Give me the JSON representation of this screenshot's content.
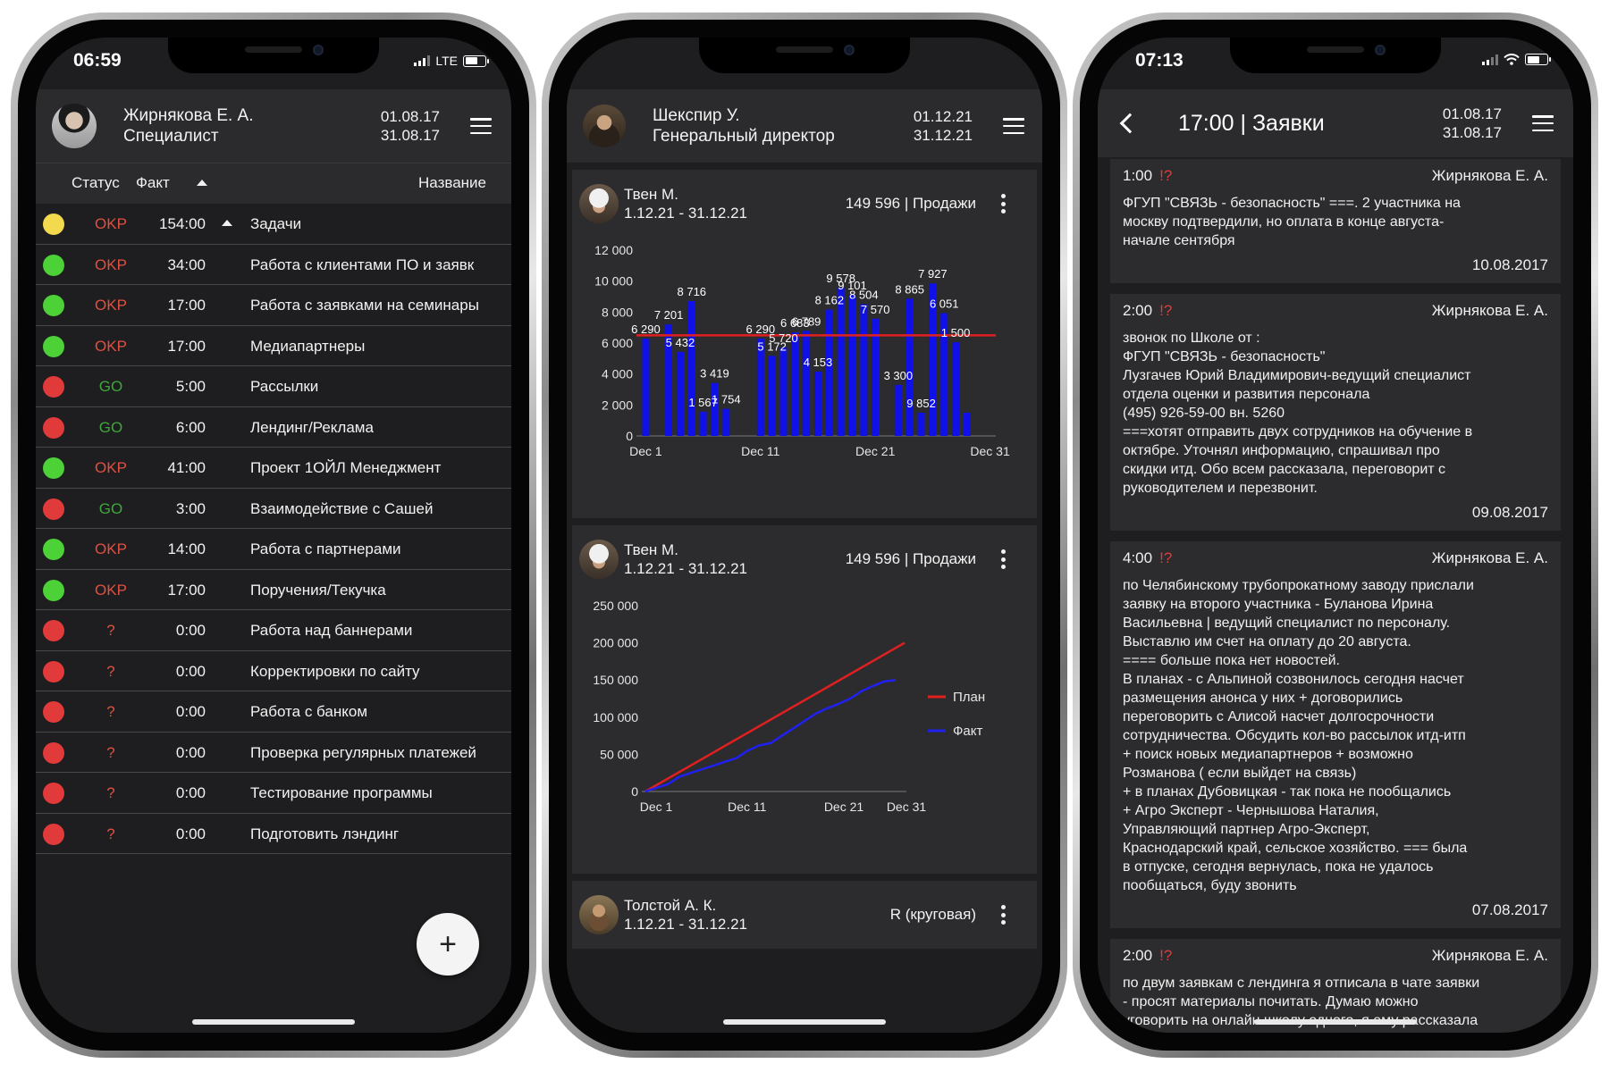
{
  "phone1": {
    "status_time": "06:59",
    "network": "LTE",
    "user_name": "Жирнякова Е. А.",
    "user_role": "Специалист",
    "date_from": "01.08.17",
    "date_to": "31.08.17",
    "columns": {
      "status": "Статус",
      "fact": "Факт",
      "name": "Название"
    },
    "tasks": [
      {
        "dot": "#f2d94e",
        "status": "OKP",
        "status_color": "#e05040",
        "fact": "154:00",
        "title": "Задачи",
        "arrow": true
      },
      {
        "dot": "#4cd137",
        "status": "OKP",
        "status_color": "#e05040",
        "fact": "34:00",
        "title": "Работа с клиентами ПО и заявк"
      },
      {
        "dot": "#4cd137",
        "status": "OKP",
        "status_color": "#e05040",
        "fact": "17:00",
        "title": "Работа с заявками на семинары"
      },
      {
        "dot": "#4cd137",
        "status": "OKP",
        "status_color": "#e05040",
        "fact": "17:00",
        "title": "Медиапартнеры"
      },
      {
        "dot": "#e03a3a",
        "status": "GO",
        "status_color": "#3fa83a",
        "fact": "5:00",
        "title": "Рассылки"
      },
      {
        "dot": "#e03a3a",
        "status": "GO",
        "status_color": "#3fa83a",
        "fact": "6:00",
        "title": "Лендинг/Реклама"
      },
      {
        "dot": "#4cd137",
        "status": "OKP",
        "status_color": "#e05040",
        "fact": "41:00",
        "title": "Проект 1ОЙЛ Менеджмент"
      },
      {
        "dot": "#e03a3a",
        "status": "GO",
        "status_color": "#3fa83a",
        "fact": "3:00",
        "title": "Взаимодействие с Сашей"
      },
      {
        "dot": "#4cd137",
        "status": "OKP",
        "status_color": "#e05040",
        "fact": "14:00",
        "title": "Работа с партнерами"
      },
      {
        "dot": "#4cd137",
        "status": "OKP",
        "status_color": "#e05040",
        "fact": "17:00",
        "title": "Поручения/Текучка"
      },
      {
        "dot": "#e03a3a",
        "status": "?",
        "status_color": "#e05040",
        "fact": "0:00",
        "title": "Работа над баннерами"
      },
      {
        "dot": "#e03a3a",
        "status": "?",
        "status_color": "#e05040",
        "fact": "0:00",
        "title": "Корректировки по сайту"
      },
      {
        "dot": "#e03a3a",
        "status": "?",
        "status_color": "#e05040",
        "fact": "0:00",
        "title": "Работа с банком"
      },
      {
        "dot": "#e03a3a",
        "status": "?",
        "status_color": "#e05040",
        "fact": "0:00",
        "title": "Проверка регулярных платежей"
      },
      {
        "dot": "#e03a3a",
        "status": "?",
        "status_color": "#e05040",
        "fact": "0:00",
        "title": "Тестирование программы"
      },
      {
        "dot": "#e03a3a",
        "status": "?",
        "status_color": "#e05040",
        "fact": "0:00",
        "title": "Подготовить лэндинг"
      }
    ],
    "fab_label": "+"
  },
  "phone2": {
    "user_name": "Шекспир У.",
    "user_role": "Генеральный директор",
    "date_from": "01.12.21",
    "date_to": "31.12.21",
    "cards": [
      {
        "name": "Твен М.",
        "period": "1.12.21 - 31.12.21",
        "summary": "149 596 | Продажи"
      },
      {
        "name": "Твен М.",
        "period": "1.12.21 - 31.12.21",
        "summary": "149 596 | Продажи"
      },
      {
        "name": "Толстой А. К.",
        "period": "1.12.21 - 31.12.21",
        "summary": "R (круговая)"
      }
    ]
  },
  "phone3": {
    "status_time": "07:13",
    "title": "17:00 | Заявки",
    "date_from": "01.08.17",
    "date_to": "31.08.17",
    "requests": [
      {
        "time": "1:00",
        "flag": "!?",
        "author": "Жирнякова Е. А.",
        "text": "ФГУП \"СВЯЗЬ - безопасность\"  ===. 2 участника на\nмоскву подтвердили, но оплата в конце августа-\nначале сентября",
        "date": "10.08.2017"
      },
      {
        "time": "2:00",
        "flag": "!?",
        "author": "Жирнякова Е. А.",
        "text": "звонок по Школе от :\nФГУП \"СВЯЗЬ - безопасность\"\nЛузгачев Юрий Владимирович-ведущий специалист\nотдела оценки и развития персонала\n(495) 926-59-00 вн. 5260\n===хотят отправить двух сотрудников на обучение в\nоктябре. Уточнял информацию, спрашивал про\nскидки итд. Обо всем рассказала, переговорит с\nруководителем и перезвонит.",
        "date": "09.08.2017"
      },
      {
        "time": "4:00",
        "flag": "!?",
        "author": "Жирнякова Е. А.",
        "text": "по Челябинскому трубопрокатному заводу прислали\nзаявку на второго участника - Буланова Ирина\nВасильевна  | ведущий специалист по персоналу.\nВыставлю им счет на оплату до 20 августа.\n==== больше пока нет новостей.\nВ планах - с Альпиной созвонилось сегодня насчет\nразмещения анонса у них + договорились\nпереговорить с Алисой насчет долгосрочности\nсотрудничества. Обсудить кол-во рассылок итд-итп\n+ поиск новых медиапартнеров + возможно\nРозманова ( если выйдет на связь)\n+ в планах Дубовицкая - так пока не пообщались\n+ Агро Эксперт -  Чернышова Наталия,\nУправляющий партнер Агро-Эксперт,\nКраснодарский край, сельское хозяйство. === была\nв отпуске, сегодня вернулась, пока не удалось\nпообщаться, буду звонить",
        "date": "07.08.2017"
      },
      {
        "time": "2:00",
        "flag": "!?",
        "author": "Жирнякова Е. А.",
        "text": "по двум заявкам с лендинга я отписала в чате заявки\n- просят материалы почитать. Думаю можно\nуговорить на онлайн школу одного, я ему рассказала\nкратко, заинтересовался.",
        "date": ""
      }
    ]
  },
  "chart_data": [
    {
      "type": "bar",
      "x_tick_labels": [
        "Dec 1",
        "Dec 11",
        "Dec 21",
        "Dec 31"
      ],
      "ylim": [
        0,
        12000
      ],
      "y_ticks": [
        "0",
        "2 000",
        "4 000",
        "6 000",
        "8 000",
        "10 000",
        "12 000"
      ],
      "values": [
        6290,
        0,
        7201,
        5432,
        8716,
        1567,
        3419,
        1754,
        0,
        0,
        6290,
        5172,
        5720,
        6683,
        6789,
        4153,
        8162,
        9578,
        9101,
        8504,
        7570,
        0,
        3300,
        8865,
        1500,
        9852,
        7927,
        6051,
        1500,
        0,
        0
      ],
      "data_labels": [
        "6 290",
        "7 201",
        "5 432",
        "8 716",
        "1 567",
        "3 419",
        "1 754",
        "6 290",
        "5 172",
        "5 720",
        "6 683",
        "6 789",
        "4 153",
        "8 162",
        "9 578",
        "9 101",
        "8 504",
        "7 570",
        "3 300",
        "8 865",
        "9 852",
        "7 927",
        "6 051",
        "1 500"
      ],
      "plan_line": 6500,
      "bar_color": "#1010e8",
      "plan_color": "#e02020"
    },
    {
      "type": "line",
      "x_tick_labels": [
        "Dec 1",
        "Dec 11",
        "Dec 21",
        "Dec 31"
      ],
      "ylim": [
        0,
        250000
      ],
      "y_ticks": [
        "0",
        "50 000",
        "100 000",
        "150 000",
        "200 000",
        "250 000"
      ],
      "series": [
        {
          "name": "План",
          "color": "#e02020",
          "values": [
            0,
            200000
          ]
        },
        {
          "name": "Факт",
          "color": "#2020f0",
          "values": [
            0,
            5000,
            10000,
            20000,
            25000,
            30000,
            35000,
            40000,
            45000,
            55000,
            62000,
            65000,
            75000,
            85000,
            95000,
            105000,
            112000,
            118000,
            125000,
            135000,
            142000,
            148000,
            150000
          ]
        }
      ]
    }
  ]
}
